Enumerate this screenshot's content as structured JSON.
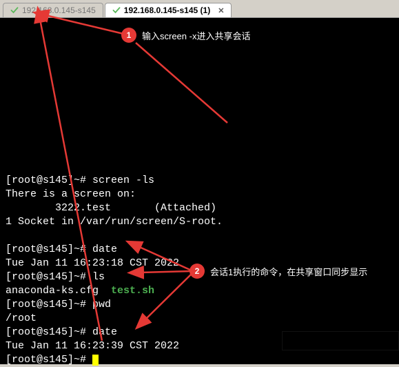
{
  "tabs": [
    {
      "label": "192.168.0.145-s145",
      "active": false
    },
    {
      "label": "192.168.0.145-s145 (1)",
      "active": true
    }
  ],
  "annotations": {
    "a1": {
      "num": "1",
      "text": "输入screen -x进入共享会话"
    },
    "a2": {
      "num": "2",
      "text": "会话1执行的命令，在共享窗口同步显示"
    }
  },
  "terminal": {
    "blank_top_lines": 11,
    "l1_prompt": "[root@s145]~# ",
    "l1_cmd": "screen -ls",
    "l2": "There is a screen on:",
    "l3": "        3222.test       (Attached)",
    "l4": "1 Socket in /var/run/screen/S-root.",
    "l5": "",
    "l6_prompt": "[root@s145]~# ",
    "l6_cmd": "date",
    "l7": "Tue Jan 11 16:23:18 CST 2022",
    "l8_prompt": "[root@s145]~# ",
    "l8_cmd": "ls",
    "l9_a": "anaconda-ks.cfg",
    "l9_b": "test.sh",
    "l10_prompt": "[root@s145]~# ",
    "l10_cmd": "pwd",
    "l11": "/root",
    "l12_prompt": "[root@s145]~# ",
    "l12_cmd": "date",
    "l13": "Tue Jan 11 16:23:39 CST 2022",
    "l14_prompt": "[root@s145]~# "
  },
  "colors": {
    "accent_red": "#e53935",
    "term_green": "#4caf50"
  }
}
